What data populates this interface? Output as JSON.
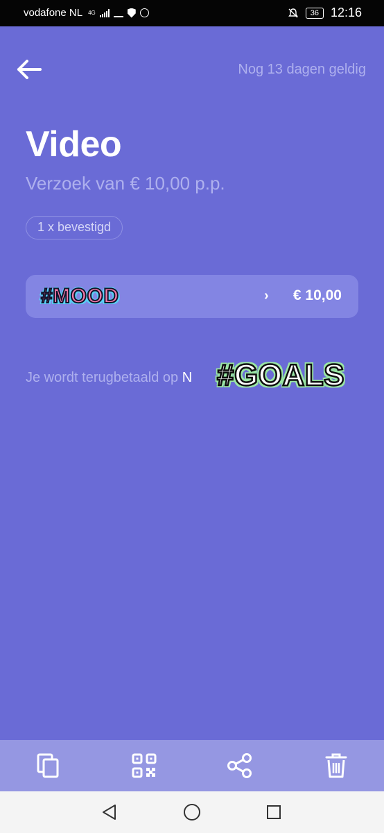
{
  "status_bar": {
    "carrier": "vodafone NL",
    "network": "4G",
    "battery": "36",
    "time": "12:16"
  },
  "header": {
    "back_icon": "arrow-left-icon",
    "validity": "Nog 13 dagen geldig"
  },
  "request": {
    "title": "Video",
    "subtitle": "Verzoek van € 10,00 p.p.",
    "confirmed_chip": "1 x bevestigd"
  },
  "payment_row": {
    "sticker": "#MOOD",
    "chevron": "›",
    "amount": "€ 10,00"
  },
  "refund": {
    "text": "Je wordt terugbetaald op ",
    "account_partial": "N",
    "sticker": "#GOALS"
  },
  "toolbar": {
    "items": [
      {
        "icon": "copy-icon"
      },
      {
        "icon": "qr-code-icon"
      },
      {
        "icon": "share-icon"
      },
      {
        "icon": "trash-icon"
      }
    ]
  },
  "nav": {
    "back": "nav-back-icon",
    "home": "nav-home-icon",
    "recents": "nav-recents-icon"
  },
  "colors": {
    "background": "#6a6bd6",
    "row_background": "#8385e3",
    "muted_text": "#aeb0ee",
    "toolbar": "#9597e2"
  }
}
